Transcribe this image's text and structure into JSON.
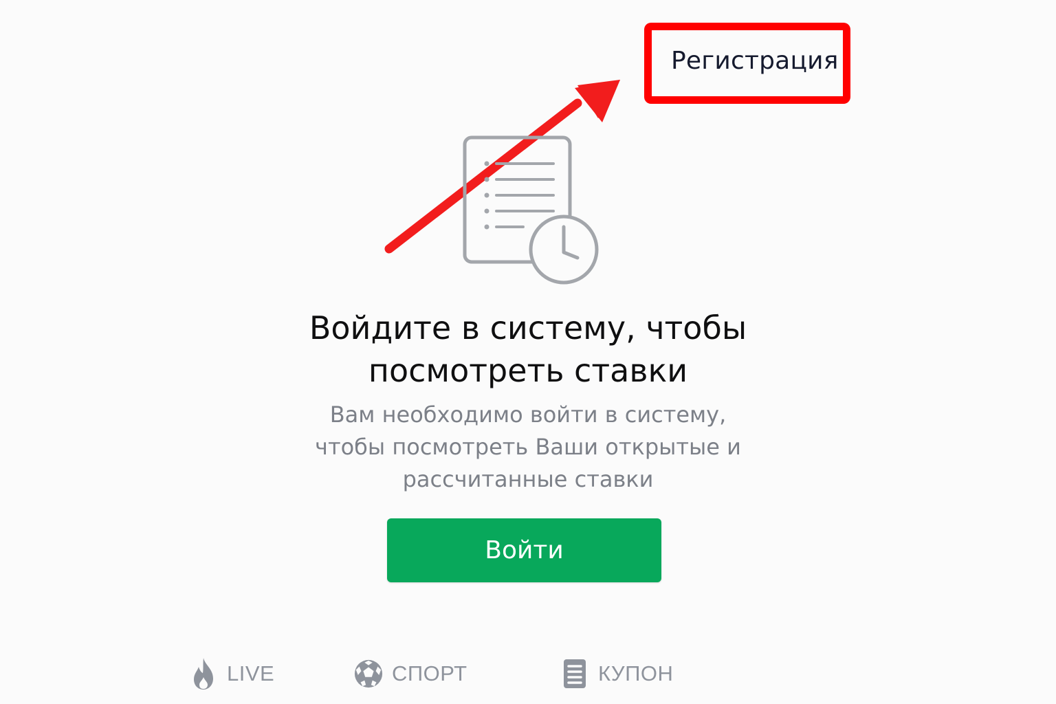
{
  "header": {
    "register_label": "Регистрация"
  },
  "empty_state": {
    "title_line1": "Войдите в систему, чтобы",
    "title_line2": "посмотреть ставки",
    "subtitle_line1": "Вам необходимо войти в систему,",
    "subtitle_line2": "чтобы посмотреть Ваши открытые и",
    "subtitle_line3": "рассчитанные ставки",
    "illustration_icon": "document-clock-icon",
    "login_label": "Войти"
  },
  "bottom_nav": {
    "items": [
      {
        "label": "LIVE",
        "icon": "flame-icon"
      },
      {
        "label": "СПОРТ",
        "icon": "soccer-ball-icon"
      },
      {
        "label": "КУПОН",
        "icon": "coupon-icon"
      }
    ]
  },
  "annotation": {
    "arrow_icon": "red-arrow-icon",
    "highlight_color": "#ff0000"
  },
  "colors": {
    "accent_green": "#08a85b",
    "muted_text": "#7c8088",
    "nav_gray": "#8e939c"
  }
}
